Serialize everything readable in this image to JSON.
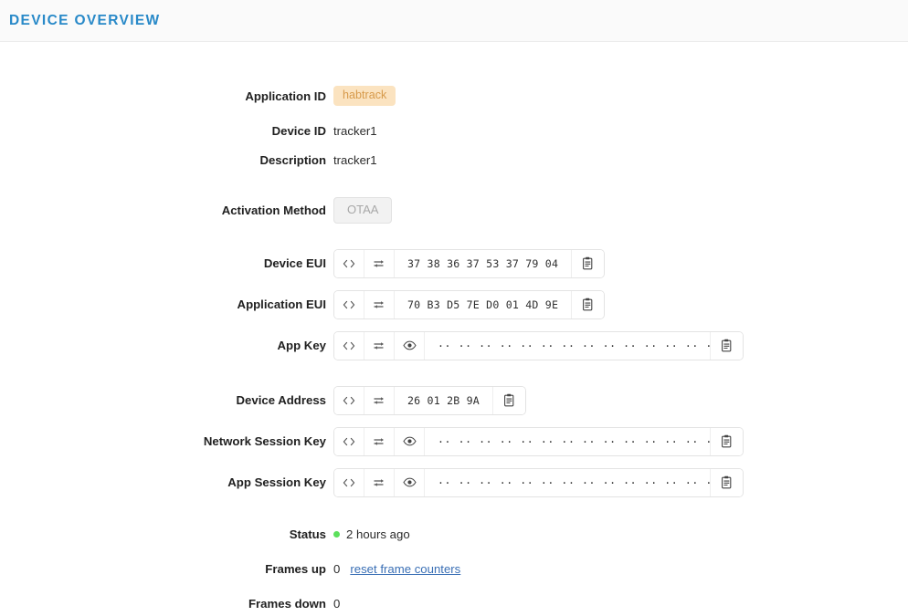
{
  "header": {
    "title": "Device Overview",
    "title_color": "#2889c8",
    "background": "#fafafa"
  },
  "fields": {
    "application_id": {
      "label": "Application ID",
      "value": "habtrack",
      "badge_bg": "#fbe3c0",
      "badge_color": "#d79a4a"
    },
    "device_id": {
      "label": "Device ID",
      "value": "tracker1"
    },
    "description": {
      "label": "Description",
      "value": "tracker1"
    },
    "activation_method": {
      "label": "Activation Method",
      "value": "OTAA"
    },
    "device_eui": {
      "label": "Device EUI",
      "value": "37 38 36 37 53 37 79 04"
    },
    "application_eui": {
      "label": "Application EUI",
      "value": "70 B3 D5 7E D0 01 4D 9E"
    },
    "app_key": {
      "label": "App Key",
      "value": "·· ·· ·· ·· ·· ·· ·· ·· ·· ·· ·· ·· ·· ·· ·· ··",
      "masked": true
    },
    "device_address": {
      "label": "Device Address",
      "value": "26 01 2B 9A"
    },
    "network_session_key": {
      "label": "Network Session Key",
      "value": "·· ·· ·· ·· ·· ·· ·· ·· ·· ·· ·· ·· ·· ·· ·· ··",
      "masked": true
    },
    "app_session_key": {
      "label": "App Session Key",
      "value": "·· ·· ·· ·· ·· ·· ·· ·· ·· ·· ·· ·· ·· ·· ·· ··",
      "masked": true
    },
    "status": {
      "label": "Status",
      "value": "2 hours ago",
      "dot_color": "#5ce05c"
    },
    "frames_up": {
      "label": "Frames up",
      "value": "0",
      "reset_link": "reset frame counters",
      "link_color": "#3a6fb5"
    },
    "frames_down": {
      "label": "Frames down",
      "value": "0"
    }
  },
  "icons": {
    "code": "code-brackets-icon",
    "swap": "swap-format-icon",
    "eye": "eye-reveal-icon",
    "copy": "clipboard-copy-icon"
  }
}
